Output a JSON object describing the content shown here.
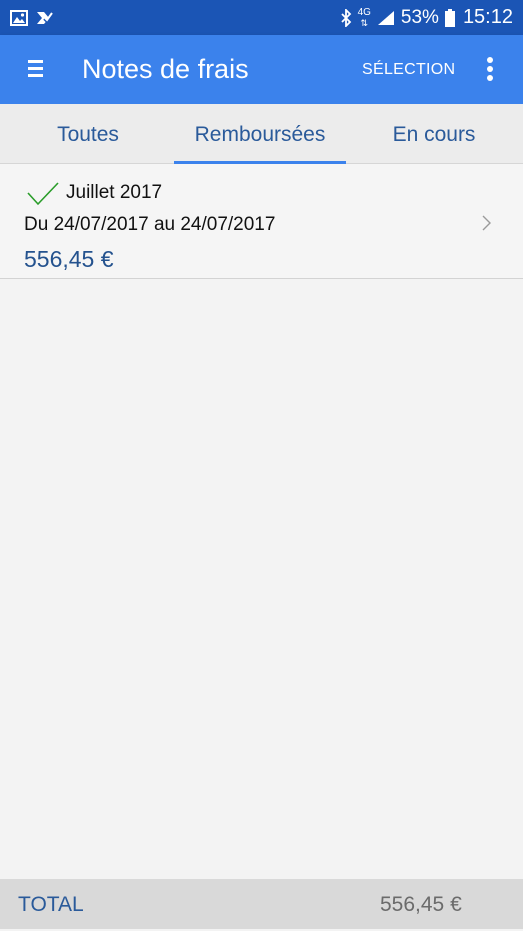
{
  "status_bar": {
    "left_icons": [
      "image-icon",
      "assistant-icon"
    ],
    "right_icons": [
      "bluetooth-icon",
      "network-4g-icon",
      "signal-icon",
      "battery-icon"
    ],
    "network": "4G",
    "battery": "53%",
    "time": "15:12"
  },
  "app_bar": {
    "title": "Notes de frais",
    "selection_label": "SÉLECTION",
    "menu_icon": "hamburger-menu-icon",
    "more_icon": "more-vertical-icon",
    "color": "#3b82ec"
  },
  "tabs": [
    {
      "label": "Toutes",
      "active": false
    },
    {
      "label": "Remboursées",
      "active": true
    },
    {
      "label": "En cours",
      "active": false
    }
  ],
  "expense_list": [
    {
      "title": "Juillet 2017",
      "dates": "Du 24/07/2017 au 24/07/2017",
      "amount": "556,45 €",
      "status_icon": "check-icon",
      "status_color": "#2a9d2a"
    }
  ],
  "footer": {
    "label": "TOTAL",
    "value": "556,45 €"
  }
}
